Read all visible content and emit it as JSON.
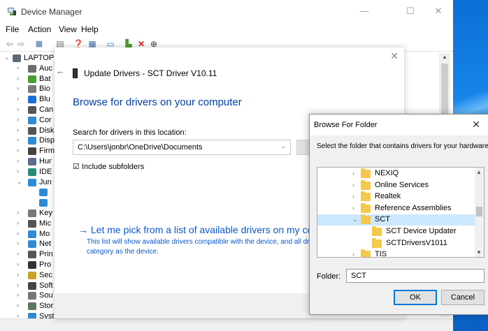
{
  "device_manager": {
    "title": "Device Manager",
    "menu": [
      "File",
      "Action",
      "View",
      "Help"
    ],
    "tree": [
      {
        "chev": "⌄",
        "label": "LAPTOP",
        "color": "#5a6b7b"
      },
      {
        "chev": "›",
        "label": "Auc",
        "color": "#6d6d6d"
      },
      {
        "chev": "›",
        "label": "Bat",
        "color": "#4a9e2f"
      },
      {
        "chev": "›",
        "label": "Bio",
        "color": "#7a7a7a"
      },
      {
        "chev": "›",
        "label": "Blu",
        "color": "#1a6fd6"
      },
      {
        "chev": "›",
        "label": "Can",
        "color": "#555555"
      },
      {
        "chev": "›",
        "label": "Cor",
        "color": "#2f8ad6"
      },
      {
        "chev": "›",
        "label": "Disk",
        "color": "#555555"
      },
      {
        "chev": "›",
        "label": "Disp",
        "color": "#2f8ad6"
      },
      {
        "chev": "›",
        "label": "Firm",
        "color": "#444444"
      },
      {
        "chev": "›",
        "label": "Hur",
        "color": "#5a6b8b"
      },
      {
        "chev": "›",
        "label": "IDE",
        "color": "#2a8a7a"
      },
      {
        "chev": "⌄",
        "label": "Jun",
        "color": "#2f8ad6"
      },
      {
        "chev": "",
        "label": "",
        "color": "#2f8ad6"
      },
      {
        "chev": "",
        "label": "",
        "color": "#2f8ad6"
      },
      {
        "chev": "›",
        "label": "Key",
        "color": "#777777"
      },
      {
        "chev": "›",
        "label": "Mic",
        "color": "#555555"
      },
      {
        "chev": "›",
        "label": "Mo",
        "color": "#2f8ad6"
      },
      {
        "chev": "›",
        "label": "Net",
        "color": "#2f8ad6"
      },
      {
        "chev": "›",
        "label": "Prin",
        "color": "#555555"
      },
      {
        "chev": "›",
        "label": "Pro",
        "color": "#333333"
      },
      {
        "chev": "›",
        "label": "Sec",
        "color": "#c9a227"
      },
      {
        "chev": "›",
        "label": "Soft",
        "color": "#444444"
      },
      {
        "chev": "›",
        "label": "Sou",
        "color": "#777777"
      },
      {
        "chev": "›",
        "label": "Stor",
        "color": "#5a7a5a"
      },
      {
        "chev": "›",
        "label": "Syst",
        "color": "#2f8ad6"
      }
    ]
  },
  "update_drivers": {
    "title": "Update Drivers - SCT Driver V10.11",
    "heading": "Browse for drivers on your computer",
    "search_label": "Search for drivers in this location:",
    "path_value": "C:\\Users\\jonbr\\OneDrive\\Documents",
    "include_subfolders": "☑ Include subfolders",
    "pick_link": "→  Let me pick from a list of available drivers on my compu",
    "pick_desc": "This list will show available drivers compatible with the device, and all driv category as the device."
  },
  "browse_folder": {
    "title": "Browse For Folder",
    "description": "Select the folder that contains drivers for your hardware.",
    "folders": [
      {
        "name": "NEXIQ",
        "chev": "›",
        "indent": 0,
        "selected": false
      },
      {
        "name": "Online Services",
        "chev": "›",
        "indent": 0,
        "selected": false
      },
      {
        "name": "Realtek",
        "chev": "›",
        "indent": 0,
        "selected": false
      },
      {
        "name": "Reference Assemblies",
        "chev": "›",
        "indent": 0,
        "selected": false
      },
      {
        "name": "SCT",
        "chev": "⌄",
        "indent": 0,
        "selected": true
      },
      {
        "name": "SCT Device Updater",
        "chev": "",
        "indent": 1,
        "selected": false
      },
      {
        "name": "SCTDriversV1011",
        "chev": "",
        "indent": 1,
        "selected": false
      },
      {
        "name": "TIS",
        "chev": "›",
        "indent": 0,
        "selected": false
      }
    ],
    "folder_label": "Folder:",
    "folder_value": "SCT",
    "ok_label": "OK",
    "cancel_label": "Cancel"
  }
}
